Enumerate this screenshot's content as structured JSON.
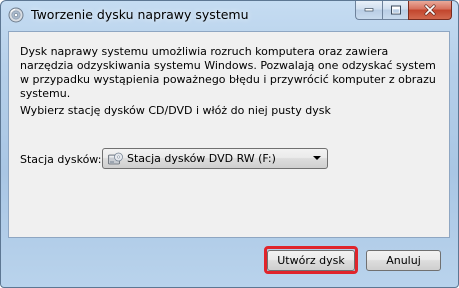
{
  "window": {
    "title": "Tworzenie dysku naprawy systemu",
    "icons": {
      "app": "disc-icon",
      "minimize": "minimize-icon",
      "maximize": "maximize-icon",
      "close": "close-icon"
    }
  },
  "main": {
    "description": "Dysk naprawy systemu umożliwia rozruch komputera oraz zawiera narzędzia odzyskiwania systemu Windows. Pozwalają one odzyskać system w przypadku wystąpienia poważnego błędu i przywrócić komputer z obrazu systemu.",
    "instruction": "Wybierz stację dysków CD/DVD i włóż do niej pusty dysk",
    "drive_label": "Stacja dysków:",
    "drive_value": "Stacja dysków DVD RW (F:)",
    "drive_icon": "optical-drive-icon"
  },
  "footer": {
    "create_label": "Utwórz dysk",
    "cancel_label": "Anuluj"
  },
  "colors": {
    "highlight": "#e0242b",
    "close_button": "#c2452d"
  }
}
